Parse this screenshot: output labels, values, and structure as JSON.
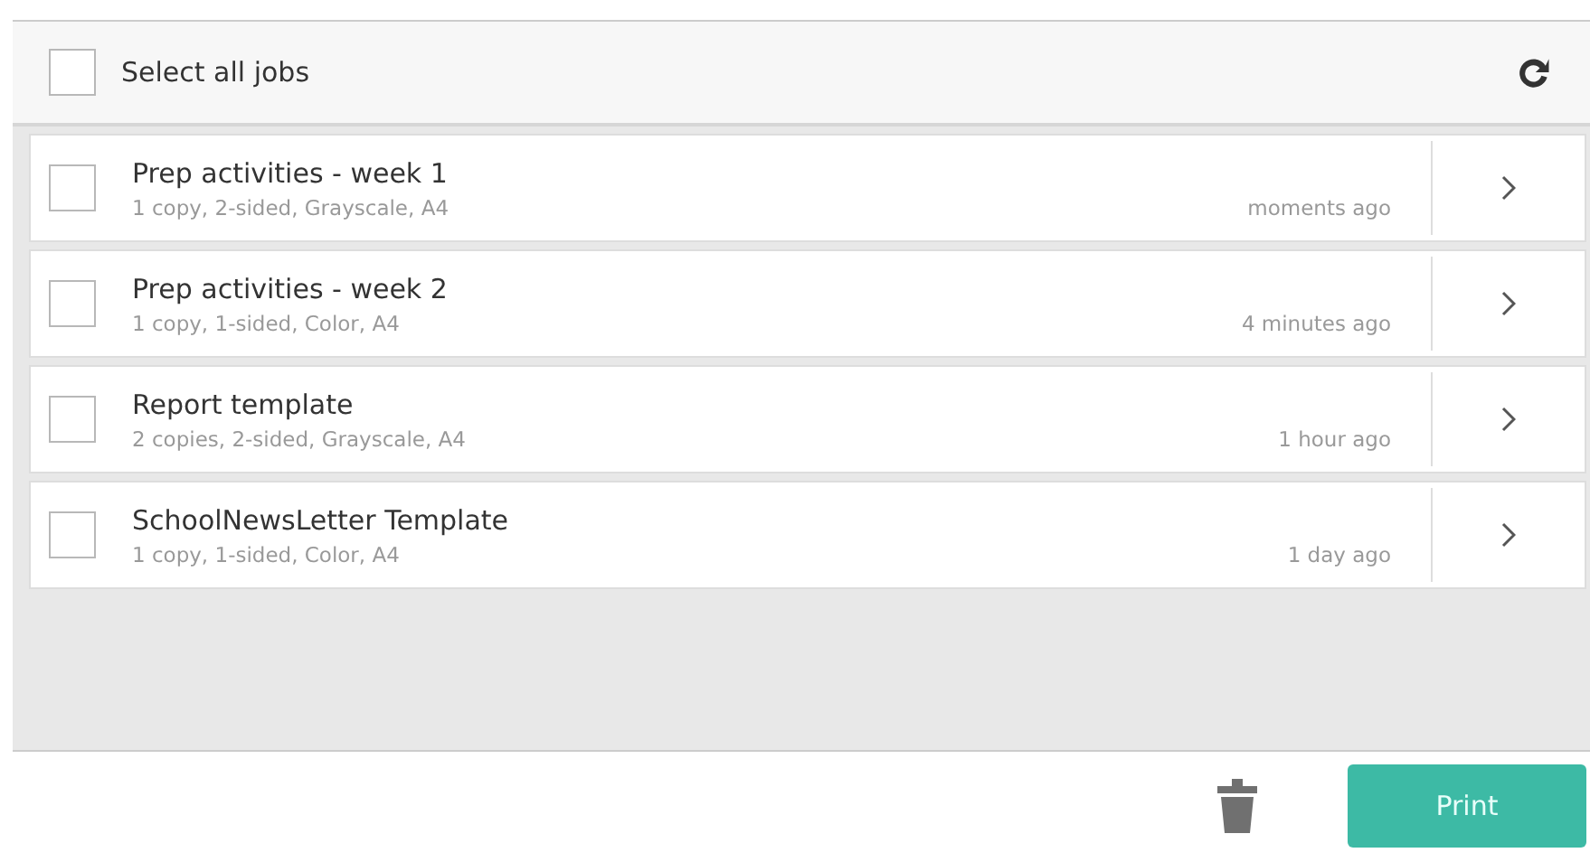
{
  "header": {
    "select_all": {
      "label": "Select all jobs",
      "checked": false
    }
  },
  "jobs": [
    {
      "title": "Prep activities - week 1",
      "details": "1 copy, 2-sided, Grayscale, A4",
      "time": "moments ago",
      "checked": false
    },
    {
      "title": "Prep activities - week 2",
      "details": "1 copy, 1-sided, Color, A4",
      "time": "4 minutes ago",
      "checked": false
    },
    {
      "title": "Report template",
      "details": "2 copies, 2-sided, Grayscale, A4",
      "time": "1 hour ago",
      "checked": false
    },
    {
      "title": "SchoolNewsLetter Template",
      "details": "1 copy, 1-sided, Color, A4",
      "time": "1 day ago",
      "checked": false
    }
  ],
  "footer": {
    "print_button": "Print"
  }
}
